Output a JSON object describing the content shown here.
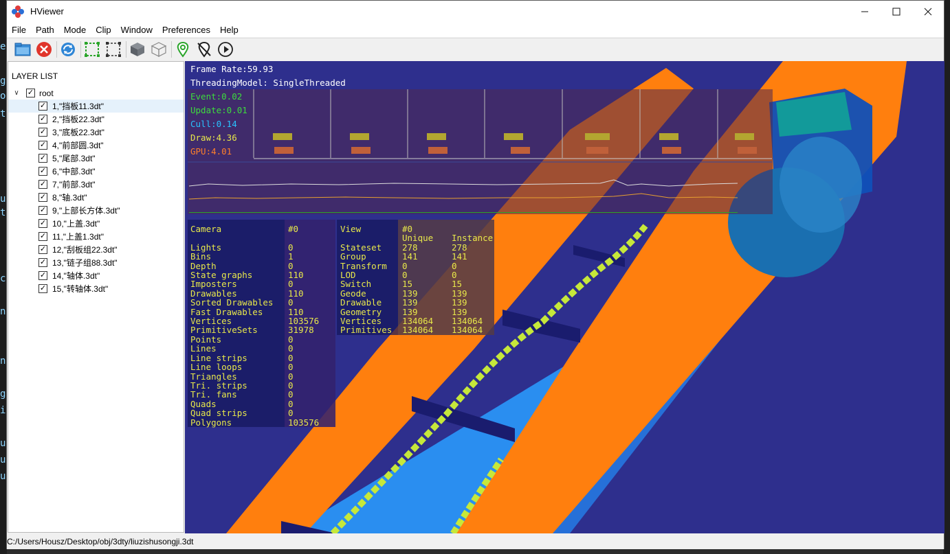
{
  "window": {
    "title": "HViewer"
  },
  "menu": [
    "File",
    "Path",
    "Mode",
    "Clip",
    "Window",
    "Preferences",
    "Help"
  ],
  "toolbar": [
    {
      "name": "open-folder-icon"
    },
    {
      "name": "close-file-icon"
    },
    {
      "name": "refresh-icon"
    },
    {
      "name": "select-box-icon"
    },
    {
      "name": "select-region-icon"
    },
    {
      "name": "solid-cube-icon"
    },
    {
      "name": "wire-cube-icon"
    },
    {
      "name": "map-pin-icon"
    },
    {
      "name": "pin-off-icon"
    },
    {
      "name": "play-icon"
    }
  ],
  "layer_list": {
    "header": "LAYER LIST",
    "root_label": "root",
    "items": [
      "1,\"挡板11.3dt\"",
      "2,\"挡板22.3dt\"",
      "3,\"底板22.3dt\"",
      "4,\"前部圆.3dt\"",
      "5,\"尾部.3dt\"",
      "6,\"中部.3dt\"",
      "7,\"前部.3dt\"",
      "8,\"轴.3dt\"",
      "9,\"上部长方体.3dt\"",
      "10,\"上盖.3dt\"",
      "11,\"上盖1.3dt\"",
      "12,\"刮板组22.3dt\"",
      "13,\"链子组88.3dt\"",
      "14,\"轴体.3dt\"",
      "15,\"转轴体.3dt\""
    ],
    "selected_index": 0
  },
  "hud": {
    "frame_rate": "Frame Rate:59.93",
    "threading": "ThreadingModel: SingleThreaded",
    "event": "Event:0.02",
    "update": "Update:0.01",
    "cull": "Cull:0.14",
    "draw": "Draw:4.36",
    "gpu": "GPU:4.01"
  },
  "camera_stats": {
    "labels": "Camera\n\nLights\nBins\nDepth\nState graphs\nImposters\nDrawables\nSorted Drawables\nFast Drawables\nVertices\nPrimitiveSets\nPoints\nLines\nLine strips\nLine loops\nTriangles\nTri. strips\nTri. fans\nQuads\nQuad strips\nPolygons",
    "values": "#0\n\n0\n1\n0\n110\n0\n110\n0\n110\n103576\n31978\n0\n0\n0\n0\n0\n0\n0\n0\n0\n103576"
  },
  "view_stats": {
    "labels": "View\n\nStateset\nGroup\nTransform\nLOD\nSwitch\nGeode\nDrawable\nGeometry\nVertices\nPrimitives",
    "unique": "#0\nUnique\n278\n141\n0\n0\n15\n139\n139\n139\n134064\n134064",
    "instance": "\nInstance\n278\n141\n0\n0\n15\n139\n139\n139\n134064\n134064"
  },
  "status": {
    "path": "C:/Users/Housz/Desktop/obj/3dty/liuzishusongji.3dt"
  },
  "colors": {
    "viewport_bg": "#2e2f8d",
    "rail_orange": "#ff7f0e",
    "trough_blue": "#2a8ef0",
    "chain_green": "#c6e83a",
    "flight_navy": "#1a1c6e",
    "hud_event": "#3ddc3d",
    "hud_cull": "#29c3ff",
    "hud_draw": "#e8e84a",
    "hud_gpu": "#ff7f2a"
  }
}
